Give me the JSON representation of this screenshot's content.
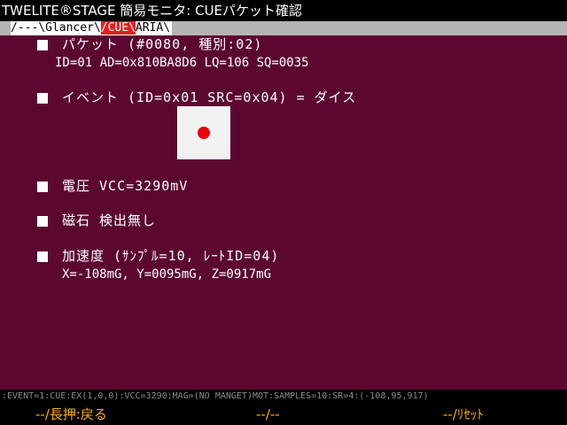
{
  "window": {
    "title": "TWELITE®STAGE 簡易モニタ: CUEパケット確認"
  },
  "tabs": {
    "prefix": "/---\\",
    "items": [
      {
        "label": "Glancer"
      },
      {
        "label": "/CUE\\"
      },
      {
        "label": "ARIA"
      }
    ],
    "sep": "\\",
    "suffix": "\\"
  },
  "packet": {
    "heading": "パケット (#0080, 種別:02)",
    "detail": "ID=01 AD=0x810BA8D6 LQ=106 SQ=0035"
  },
  "event": {
    "heading": "イベント (ID=0x01 SRC=0x04) = ダイス",
    "dice_value": 1
  },
  "voltage": {
    "heading": "電圧 VCC=3290mV"
  },
  "magnet": {
    "heading": "磁石 検出無し"
  },
  "accel": {
    "heading": "加速度 (ｻﾝﾌﾟﾙ=10, ﾚｰﾄID=04)",
    "detail": "X=-108mG, Y=0095mG, Z=0917mG"
  },
  "status_line": ":EVENT=1:CUE:EX(1,0,0):VCC=3290:MAG=(NO MANGET)MOT:SAMPLES=10:SR=4:(-108,95,917)",
  "footer": {
    "left": "--/長押:戻る",
    "center": "--/--",
    "right": "--/ﾘｾｯﾄ"
  },
  "colors": {
    "background": "#5c0730",
    "active_tab": "#e02020",
    "footer_text": "#ffb000",
    "dice_pip": "#e8000b"
  }
}
